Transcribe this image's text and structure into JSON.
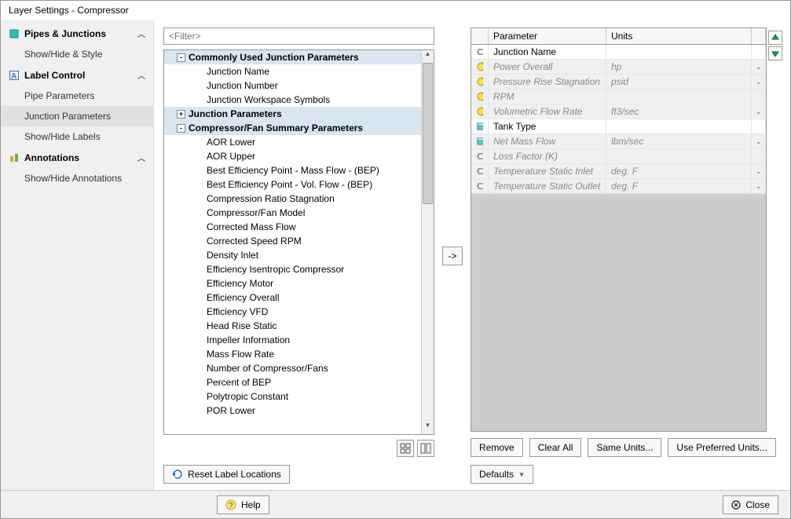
{
  "window": {
    "title": "Layer Settings - Compressor"
  },
  "sidebar": {
    "sections": [
      {
        "label": "Pipes & Junctions",
        "items": [
          {
            "label": "Show/Hide & Style"
          }
        ]
      },
      {
        "label": "Label Control",
        "items": [
          {
            "label": "Pipe Parameters"
          },
          {
            "label": "Junction Parameters",
            "selected": true
          },
          {
            "label": "Show/Hide Labels"
          }
        ]
      },
      {
        "label": "Annotations",
        "items": [
          {
            "label": "Show/Hide Annotations"
          }
        ]
      }
    ]
  },
  "filter": {
    "placeholder": "<Filter>"
  },
  "tree": {
    "groups": [
      {
        "label": "Commonly Used Junction Parameters",
        "exp": "-",
        "items": [
          "Junction Name",
          "Junction Number",
          "Junction Workspace Symbols"
        ]
      },
      {
        "label": "Junction Parameters",
        "exp": "+",
        "items": []
      },
      {
        "label": "Compressor/Fan Summary Parameters",
        "exp": "-",
        "items": [
          "AOR Lower",
          "AOR Upper",
          "Best Efficiency Point - Mass Flow - (BEP)",
          "Best Efficiency Point - Vol. Flow - (BEP)",
          "Compression Ratio Stagnation",
          "Compressor/Fan Model",
          "Corrected Mass Flow",
          "Corrected Speed RPM",
          "Density Inlet",
          "Efficiency Isentropic Compressor",
          "Efficiency Motor",
          "Efficiency Overall",
          "Efficiency VFD",
          "Head Rise Static",
          "Impeller Information",
          "Mass Flow Rate",
          "Number of Compressor/Fans",
          "Percent of BEP",
          "Polytropic Constant",
          "POR Lower"
        ]
      }
    ]
  },
  "table": {
    "headers": {
      "param": "Parameter",
      "units": "Units"
    },
    "rows": [
      {
        "icon": "junction",
        "param": "Junction Name",
        "unit": "",
        "dis": false,
        "dd": false
      },
      {
        "icon": "comp",
        "param": "Power Overall",
        "unit": "hp",
        "dis": true,
        "dd": true
      },
      {
        "icon": "comp",
        "param": "Pressure Rise Stagnation",
        "unit": "psid",
        "dis": true,
        "dd": true
      },
      {
        "icon": "comp",
        "param": "RPM",
        "unit": "",
        "dis": true,
        "dd": false
      },
      {
        "icon": "comp",
        "param": "Volumetric Flow Rate",
        "unit": "ft3/sec",
        "dis": true,
        "dd": true
      },
      {
        "icon": "tank",
        "param": "Tank Type",
        "unit": "",
        "dis": false,
        "dd": false
      },
      {
        "icon": "tank",
        "param": "Net Mass Flow",
        "unit": "lbm/sec",
        "dis": true,
        "dd": true
      },
      {
        "icon": "junction",
        "param": "Loss Factor (K)",
        "unit": "",
        "dis": true,
        "dd": false
      },
      {
        "icon": "junction",
        "param": "Temperature Static Inlet",
        "unit": "deg. F",
        "dis": true,
        "dd": true
      },
      {
        "icon": "junction",
        "param": "Temperature Static Outlet",
        "unit": "deg. F",
        "dis": true,
        "dd": true
      }
    ]
  },
  "buttons": {
    "move": "->",
    "reset": "Reset Label Locations",
    "remove": "Remove",
    "clear": "Clear All",
    "same": "Same Units...",
    "pref": "Use Preferred Units...",
    "defaults": "Defaults",
    "help": "Help",
    "close": "Close"
  }
}
